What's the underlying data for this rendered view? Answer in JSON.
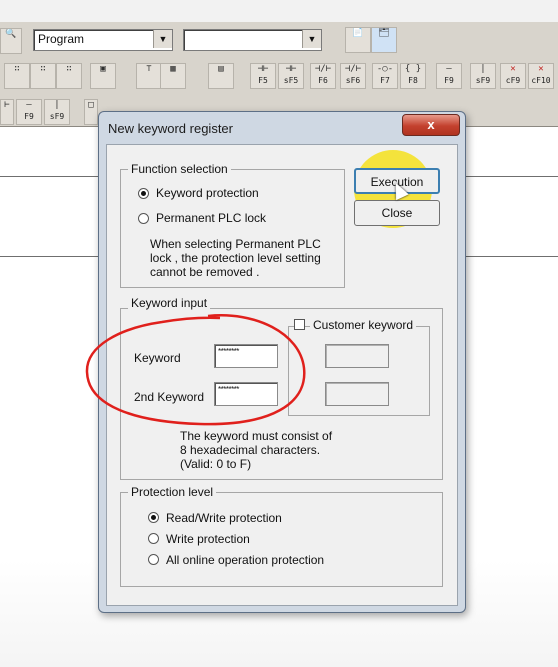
{
  "toolbar": {
    "program_combo": "Program",
    "second_combo": "",
    "fkeys_row1": [
      "F5",
      "sF5",
      "F6",
      "sF6",
      "F7",
      "F8",
      "F9",
      "sF9",
      "cF9",
      "cF10"
    ],
    "fkeys_row2": [
      "F9",
      "sF9"
    ]
  },
  "dialog": {
    "title": "New keyword register",
    "close_label": "x",
    "function_selection": {
      "label": "Function selection",
      "options": [
        "Keyword protection",
        "Permanent PLC lock"
      ],
      "selected": "Keyword protection",
      "note": [
        "When selecting Permanent PLC",
        "lock , the protection level setting",
        "cannot be removed ."
      ]
    },
    "buttons": {
      "execution": "Execution",
      "close": "Close"
    },
    "keyword_input": {
      "label": "Keyword input",
      "keyword_label": "Keyword",
      "keyword_value": "********",
      "second_keyword_label": "2nd Keyword",
      "second_keyword_value": "********",
      "customer_keyword_label": "Customer keyword",
      "note": [
        "The keyword must consist of",
        "8 hexadecimal characters.",
        "(Valid: 0 to F)"
      ]
    },
    "protection_level": {
      "label": "Protection level",
      "options": [
        "Read/Write protection",
        "Write protection",
        "All online operation protection"
      ],
      "selected": "Read/Write protection"
    }
  },
  "colors": {
    "annotation_circle": "#e0201c",
    "cursor_highlight": "#f4e11c",
    "close_button": "#c3412e"
  }
}
